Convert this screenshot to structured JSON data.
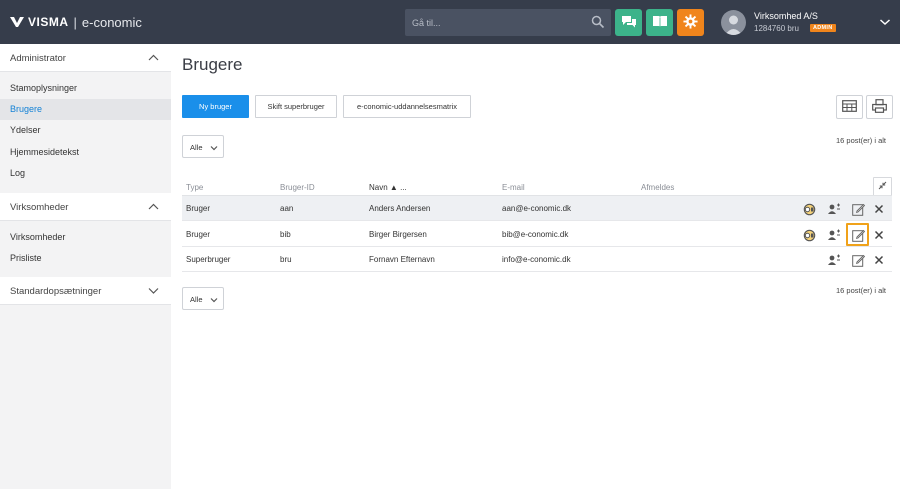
{
  "header": {
    "brand": "VISMA",
    "separator": "|",
    "product": "e-conomic",
    "search_placeholder": "Gå til...",
    "company_name": "Virksomhed A/S",
    "company_id": "1284760 bru",
    "role_badge": "ADMIN",
    "accent_green": "#3cb38a",
    "accent_orange": "#f0851c"
  },
  "sidebar": {
    "sections": [
      {
        "label": "Administrator",
        "items": [
          "Stamoplysninger",
          "Brugere",
          "Ydelser",
          "Hjemmesidetekst",
          "Log"
        ]
      },
      {
        "label": "Virksomheder",
        "items": [
          "Virksomheder",
          "Prisliste"
        ]
      },
      {
        "label": "Standardopsætninger",
        "items": []
      }
    ],
    "active_item": "Brugere"
  },
  "main": {
    "title": "Brugere",
    "buttons": {
      "new_user": "Ny bruger",
      "switch_superuser": "Skift superbruger",
      "training_matrix": "e-conomic-uddannelsesmatrix"
    },
    "filter_value": "Alle",
    "count_text": "16 post(er) i alt",
    "columns": [
      "Type",
      "Bruger-ID",
      "Navn",
      "E-mail",
      "Afmeldes"
    ],
    "sort_indicator": "▲ ...",
    "rows": [
      {
        "type": "Bruger",
        "id": "aan",
        "name": "Anders Andersen",
        "email": "aan@e-conomic.dk"
      },
      {
        "type": "Bruger",
        "id": "bib",
        "name": "Birger Birgersen",
        "email": "bib@e-conomic.dk"
      },
      {
        "type": "Superbruger",
        "id": "bru",
        "name": "Fornavn Efternavn",
        "email": "info@e-conomic.dk"
      }
    ]
  }
}
